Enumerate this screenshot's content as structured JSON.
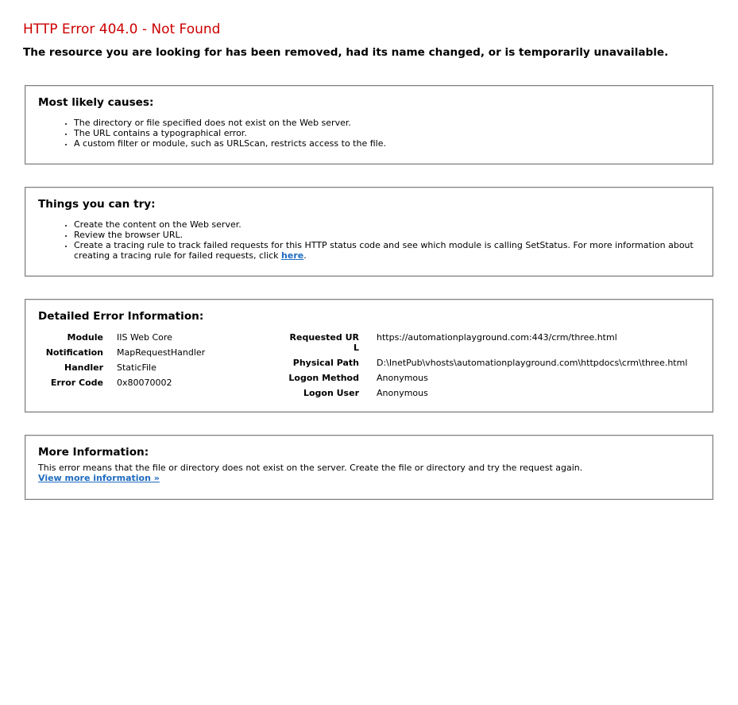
{
  "header": {
    "title": "HTTP Error 404.0 - Not Found",
    "subtitle": "The resource you are looking for has been removed, had its name changed, or is temporarily unavailable."
  },
  "causes": {
    "heading": "Most likely causes:",
    "items": [
      "The directory or file specified does not exist on the Web server.",
      "The URL contains a typographical error.",
      "A custom filter or module, such as URLScan, restricts access to the file."
    ]
  },
  "try": {
    "heading": "Things you can try:",
    "items": [
      "Create the content on the Web server.",
      "Review the browser URL.",
      "Create a tracing rule to track failed requests for this HTTP status code and see which module is calling SetStatus. For more information about creating a tracing rule for failed requests, click "
    ],
    "link_text": "here",
    "link_suffix": "."
  },
  "detail": {
    "heading": "Detailed Error Information:",
    "left": [
      {
        "label": "Module",
        "value": "IIS Web Core"
      },
      {
        "label": "Notification",
        "value": "MapRequestHandler"
      },
      {
        "label": "Handler",
        "value": "StaticFile"
      },
      {
        "label": "Error Code",
        "value": "0x80070002"
      }
    ],
    "right": [
      {
        "label": "Requested URL",
        "value": "https://automationplayground.com:443/crm/three.html"
      },
      {
        "label": "Physical Path",
        "value": "D:\\InetPub\\vhosts\\automationplayground.com\\httpdocs\\crm\\three.html"
      },
      {
        "label": "Logon Method",
        "value": "Anonymous"
      },
      {
        "label": "Logon User",
        "value": "Anonymous"
      }
    ]
  },
  "more": {
    "heading": "More Information:",
    "text": "This error means that the file or directory does not exist on the server. Create the file or directory and try the request again.",
    "link_text": "View more information »"
  },
  "colors": {
    "title": "#cc0000",
    "link": "#1f6bbf",
    "border": "#7f7f7f"
  }
}
